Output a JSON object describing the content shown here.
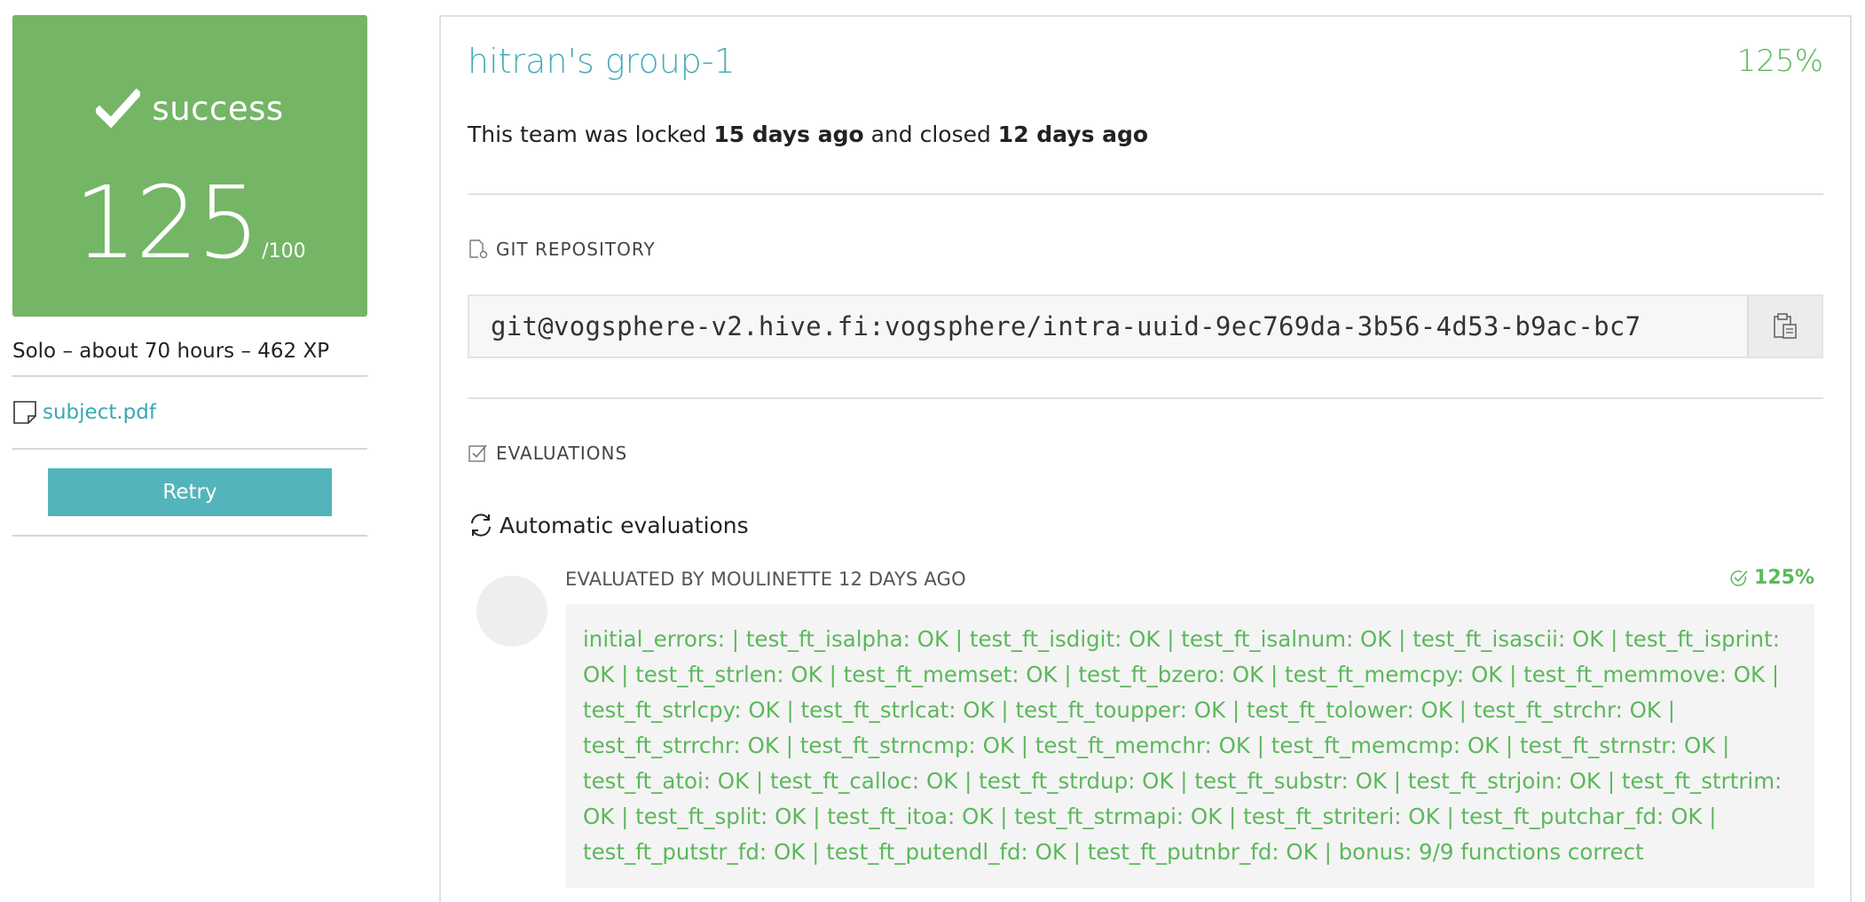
{
  "project": {
    "status": "success",
    "score": "125",
    "max_score": "/100",
    "meta": "Solo – about 70 hours – 462 XP",
    "subject_link": "subject.pdf",
    "retry_label": "Retry"
  },
  "team": {
    "title": "hitran's group-1",
    "percent": "125%",
    "lock_prefix": "This team was locked ",
    "locked_ago": "15 days ago",
    "lock_middle": " and closed ",
    "closed_ago": "12 days ago"
  },
  "git": {
    "heading": "GIT REPOSITORY",
    "url": "git@vogsphere-v2.hive.fi:vogsphere/intra-uuid-9ec769da-3b56-4d53-b9ac-bc7"
  },
  "evaluations": {
    "heading": "EVALUATIONS",
    "auto_heading": "Automatic evaluations",
    "evaluated_by": "EVALUATED BY MOULINETTE 12 DAYS AGO",
    "score": "125%",
    "trace": "initial_errors: | test_ft_isalpha: OK | test_ft_isdigit: OK | test_ft_isalnum: OK | test_ft_isascii: OK | test_ft_isprint: OK | test_ft_strlen: OK | test_ft_memset: OK | test_ft_bzero: OK | test_ft_memcpy: OK | test_ft_memmove: OK | test_ft_strlcpy: OK | test_ft_strlcat: OK | test_ft_toupper: OK | test_ft_tolower: OK | test_ft_strchr: OK | test_ft_strrchr: OK | test_ft_strncmp: OK | test_ft_memchr: OK | test_ft_memcmp: OK | test_ft_strnstr: OK | test_ft_atoi: OK | test_ft_calloc: OK | test_ft_strdup: OK | test_ft_substr: OK | test_ft_strjoin: OK | test_ft_strtrim: OK | test_ft_split: OK | test_ft_itoa: OK | test_ft_strmapi: OK | test_ft_striteri: OK | test_ft_putchar_fd: OK | test_ft_putstr_fd: OK | test_ft_putendl_fd: OK | test_ft_putnbr_fd: OK | bonus: 9/9 functions correct"
  },
  "colors": {
    "success_green": "#74b566",
    "link_teal": "#48aeb8",
    "button_teal": "#53b5bb",
    "ok_green": "#5cb85c"
  },
  "icons": {
    "status": "checkmark-icon",
    "subject": "document-icon",
    "git": "repository-icon",
    "copy": "clipboard-icon",
    "evaluations": "checkbox-icon",
    "auto": "refresh-icon",
    "eval_score": "check-circle-icon"
  }
}
